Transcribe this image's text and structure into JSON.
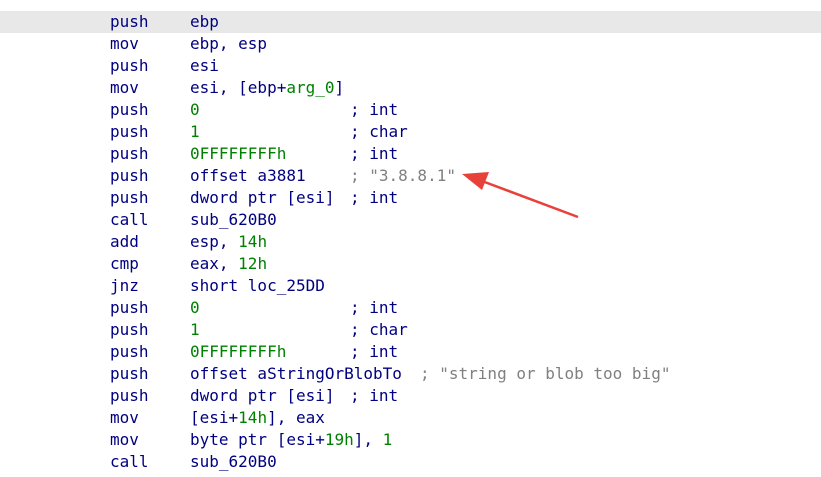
{
  "listing": [
    {
      "mnemonic": "push",
      "operands": [
        {
          "t": "ebp",
          "k": "plain"
        }
      ],
      "comment": null
    },
    {
      "mnemonic": "mov",
      "operands": [
        {
          "t": "ebp, esp",
          "k": "plain"
        }
      ],
      "comment": null
    },
    {
      "mnemonic": "push",
      "operands": [
        {
          "t": "esi",
          "k": "plain"
        }
      ],
      "comment": null
    },
    {
      "mnemonic": "mov",
      "operands": [
        {
          "t": "esi, [ebp+",
          "k": "plain"
        },
        {
          "t": "arg_0",
          "k": "num"
        },
        {
          "t": "]",
          "k": "plain"
        }
      ],
      "comment": null
    },
    {
      "mnemonic": "push",
      "operands": [
        {
          "t": "0",
          "k": "num"
        }
      ],
      "comment": {
        "text": "; int",
        "col": 350,
        "k": "type"
      }
    },
    {
      "mnemonic": "push",
      "operands": [
        {
          "t": "1",
          "k": "num"
        }
      ],
      "comment": {
        "text": "; char",
        "col": 350,
        "k": "type"
      }
    },
    {
      "mnemonic": "push",
      "operands": [
        {
          "t": "0FFFFFFFFh",
          "k": "num"
        }
      ],
      "comment": {
        "text": "; int",
        "col": 350,
        "k": "type"
      }
    },
    {
      "mnemonic": "push",
      "operands": [
        {
          "t": "offset a3881",
          "k": "plain"
        }
      ],
      "comment": {
        "text": "; \"3.8.8.1\"",
        "col": 350,
        "k": "str"
      }
    },
    {
      "mnemonic": "push",
      "operands": [
        {
          "t": "dword ptr [esi]",
          "k": "plain"
        }
      ],
      "comment": {
        "text": "; int",
        "col": 350,
        "k": "type"
      }
    },
    {
      "mnemonic": "call",
      "operands": [
        {
          "t": "sub_620B0",
          "k": "plain"
        }
      ],
      "comment": null
    },
    {
      "mnemonic": "add",
      "operands": [
        {
          "t": "esp, ",
          "k": "plain"
        },
        {
          "t": "14h",
          "k": "num"
        }
      ],
      "comment": null
    },
    {
      "mnemonic": "cmp",
      "operands": [
        {
          "t": "eax, ",
          "k": "plain"
        },
        {
          "t": "12h",
          "k": "num"
        }
      ],
      "comment": null
    },
    {
      "mnemonic": "jnz",
      "operands": [
        {
          "t": "short loc_25DD",
          "k": "plain"
        }
      ],
      "comment": null
    },
    {
      "mnemonic": "push",
      "operands": [
        {
          "t": "0",
          "k": "num"
        }
      ],
      "comment": {
        "text": "; int",
        "col": 350,
        "k": "type"
      }
    },
    {
      "mnemonic": "push",
      "operands": [
        {
          "t": "1",
          "k": "num"
        }
      ],
      "comment": {
        "text": "; char",
        "col": 350,
        "k": "type"
      }
    },
    {
      "mnemonic": "push",
      "operands": [
        {
          "t": "0FFFFFFFFh",
          "k": "num"
        }
      ],
      "comment": {
        "text": "; int",
        "col": 350,
        "k": "type"
      }
    },
    {
      "mnemonic": "push",
      "operands": [
        {
          "t": "offset aStringOrBlobTo",
          "k": "plain"
        }
      ],
      "comment": {
        "text": "; \"string or blob too big\"",
        "col": 420,
        "k": "str"
      }
    },
    {
      "mnemonic": "push",
      "operands": [
        {
          "t": "dword ptr [esi]",
          "k": "plain"
        }
      ],
      "comment": {
        "text": "; int",
        "col": 350,
        "k": "type"
      }
    },
    {
      "mnemonic": "mov",
      "operands": [
        {
          "t": "[esi+",
          "k": "plain"
        },
        {
          "t": "14h",
          "k": "num"
        },
        {
          "t": "], eax",
          "k": "plain"
        }
      ],
      "comment": null
    },
    {
      "mnemonic": "mov",
      "operands": [
        {
          "t": "byte ptr [esi+",
          "k": "plain"
        },
        {
          "t": "19h",
          "k": "num"
        },
        {
          "t": "], ",
          "k": "plain"
        },
        {
          "t": "1",
          "k": "num"
        }
      ],
      "comment": null
    },
    {
      "mnemonic": "call",
      "operands": [
        {
          "t": "sub_620B0",
          "k": "plain"
        }
      ],
      "comment": null
    }
  ],
  "highlighted_line": 0,
  "annotation": {
    "color": "#e8413a"
  },
  "colors": {
    "mnemonic": "#000080",
    "number": "#008000",
    "comment": "#808080",
    "highlight": "#e8e8e8"
  }
}
